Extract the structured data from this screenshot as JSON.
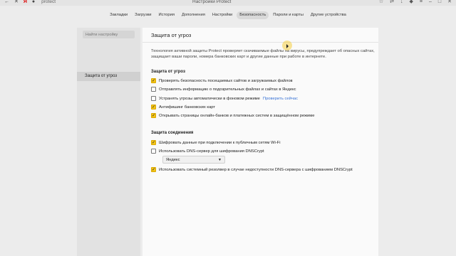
{
  "browser": {
    "address": "protect",
    "window_title": "Настройки Protect",
    "left_icons": [
      "back-icon",
      "close-icon",
      "yandex-logo-icon",
      "lock-icon"
    ],
    "right_icons": [
      "bookmark-icon",
      "translate-icon",
      "downloads-icon",
      "extensions-icon",
      "menu-icon",
      "minimize-icon",
      "maximize-icon",
      "close-window-icon"
    ]
  },
  "nav": {
    "tabs": [
      "Закладки",
      "Загрузки",
      "История",
      "Дополнения",
      "Настройки",
      "Безопасность",
      "Пароли и карты",
      "Другие устройства"
    ],
    "active": "Безопасность"
  },
  "sidebar": {
    "search_placeholder": "Найти настройку",
    "items": [
      {
        "label": "Защита от угроз"
      }
    ]
  },
  "main": {
    "title": "Защита от угроз",
    "description_line1": "Технология активной защиты Protect проверяет скачиваемые файлы на вирусы, предупреждает об опасных сайтах,",
    "description_line2": "защищает ваши пароли, номера банковских карт и другие данные при работе в интернете.",
    "threats": {
      "title": "Защита от угроз",
      "options": [
        {
          "label": "Проверять безопасность посещаемых сайтов и загружаемых файлов",
          "checked": true
        },
        {
          "label": "Отправлять информацию о подозрительных файлах и сайтах в Яндекс",
          "checked": false
        },
        {
          "label": "Устранять угрозы автоматически в фоновом режиме",
          "checked": false,
          "link": "Проверить сейчас"
        },
        {
          "label": "Антифишинг банковских карт",
          "checked": true
        },
        {
          "label": "Открывать страницы онлайн-банков и платежных систем в защищённом режиме",
          "checked": true
        }
      ]
    },
    "connection": {
      "title": "Защита соединения",
      "options": [
        {
          "label": "Шифровать данные при подключении к публичным сетям Wi-Fi",
          "checked": true
        },
        {
          "label": "Использовать DNS-сервер для шифрования DNSCrypt",
          "checked": false
        },
        {
          "label": "Использовать системный резолвер в случае недоступности DNS-сервера с шифрованием DNSCrypt",
          "checked": true
        }
      ],
      "dns_select_value": "Яндекс"
    }
  },
  "colors": {
    "checkbox_checked": "#f5c518",
    "link": "#3a74d6"
  }
}
